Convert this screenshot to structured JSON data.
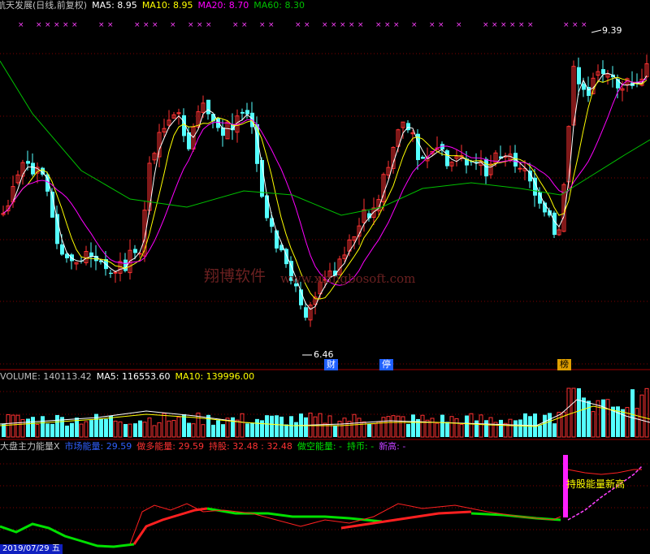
{
  "colors": {
    "bg": "#000000",
    "up": "#ff3232",
    "down": "#54ffff",
    "ma5": "#ffffff",
    "ma10": "#ffff00",
    "ma20": "#ff00ff",
    "ma60": "#00c000",
    "grid": "#7f0000"
  },
  "price_header": {
    "name": "航天发展(日线,前复权)",
    "ma5": "MA5: 8.95",
    "ma10": "MA10: 8.95",
    "ma20": "MA20: 8.70",
    "ma60": "MA60: 8.30"
  },
  "price_annotations": {
    "high": "9.39",
    "low": "6.46",
    "marker_cai": "财",
    "marker_ting": "停",
    "marker_bang": "榜"
  },
  "watermark": {
    "cn": "翔博软件",
    "url": "www.xiangbosoft.com"
  },
  "volume_header": {
    "volume": "VOLUME: 140113.42",
    "ma5": "MA5: 116553.60",
    "ma10": "MA10: 139996.00"
  },
  "indicator_header": {
    "name": "大盘主力能量X",
    "market": "市场能量: 29.59",
    "long": "做多能量: 29.59",
    "hold": "持股: 32.48 : 32.48",
    "short": "做空能量: -",
    "cash": "持币: -",
    "newhigh": "新高: -"
  },
  "indicator_annotation": "持股能量新高",
  "date_label": "2019/07/29 五",
  "chart_data": {
    "type": "candlestick",
    "price_high": 9.39,
    "price_low": 6.46,
    "ma": {
      "MA5": 8.95,
      "MA10": 8.95,
      "MA20": 8.7,
      "MA60": 8.3
    },
    "volume": {
      "last": 140113.42,
      "MA5": 116553.6,
      "MA10": 139996.0
    },
    "indicator": {
      "market_energy": 29.59,
      "long_energy": 29.59,
      "hold": 32.48
    }
  }
}
